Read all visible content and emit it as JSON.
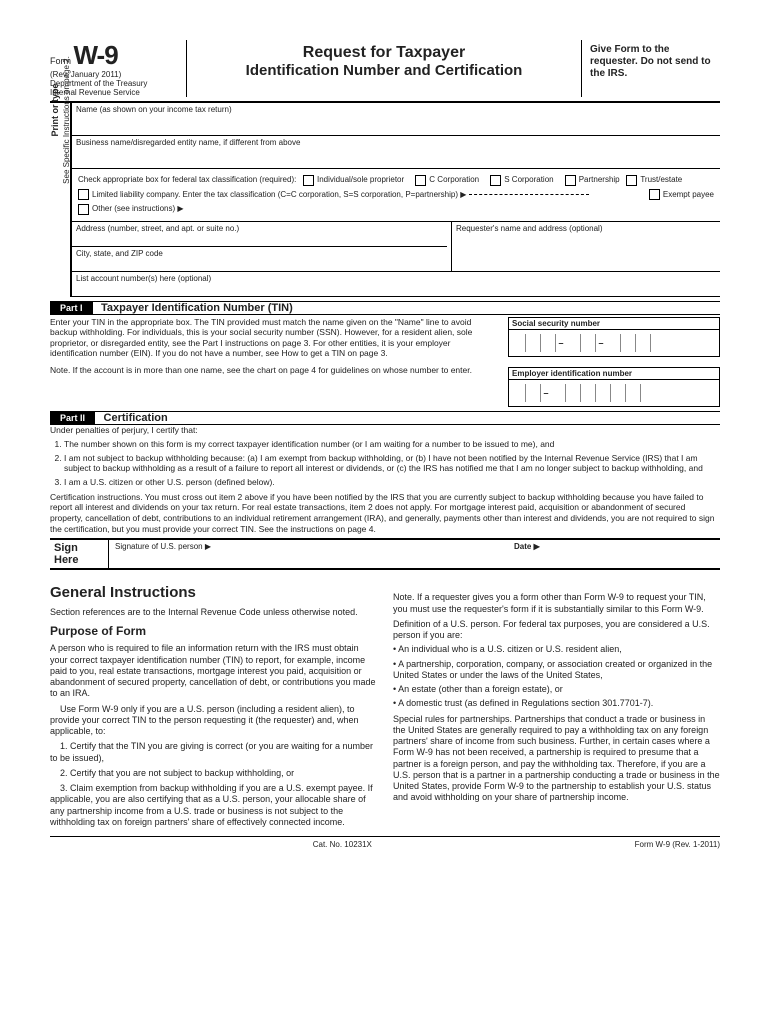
{
  "header": {
    "form_word": "Form",
    "form_number": "W-9",
    "revision": "(Rev. January 2011)",
    "dept": "Department of the Treasury",
    "irs": "Internal Revenue Service",
    "title1": "Request for Taxpayer",
    "title2": "Identification Number and Certification",
    "right": "Give Form to the requester. Do not send to the IRS."
  },
  "side_label_bold": "Print or type",
  "side_label": "See Specific Instructions on page 2.",
  "fields": {
    "name": "Name (as shown on your income tax return)",
    "business": "Business name/disregarded entity name, if different from above",
    "class_intro": "Check appropriate box for federal tax classification (required):",
    "c_individual": "Individual/sole proprietor",
    "c_ccorp": "C Corporation",
    "c_scorp": "S Corporation",
    "c_partnership": "Partnership",
    "c_trust": "Trust/estate",
    "c_exempt": "Exempt payee",
    "c_llc": "Limited liability company. Enter the tax classification (C=C corporation, S=S corporation, P=partnership) ▶",
    "c_other": "Other (see instructions) ▶",
    "address": "Address (number, street, and apt. or suite no.)",
    "requester": "Requester's name and address (optional)",
    "city": "City, state, and ZIP code",
    "accounts": "List account number(s) here (optional)"
  },
  "part1": {
    "label": "Part I",
    "title": "Taxpayer Identification Number (TIN)",
    "p1": "Enter your TIN in the appropriate box. The TIN provided must match the name given on the \"Name\" line to avoid backup withholding. For individuals, this is your social security number (SSN). However, for a resident alien, sole proprietor, or disregarded entity, see the Part I instructions on page 3. For other entities, it is your employer identification number (EIN). If you do not have a number, see How to get a TIN on page 3.",
    "p2": "Note. If the account is in more than one name, see the chart on page 4 for guidelines on whose number to enter.",
    "ssn": "Social security number",
    "ein": "Employer identification number"
  },
  "part2": {
    "label": "Part II",
    "title": "Certification",
    "intro": "Under penalties of perjury, I certify that:",
    "i1": "The number shown on this form is my correct taxpayer identification number (or I am waiting for a number to be issued to me), and",
    "i2": "I am not subject to backup withholding because: (a) I am exempt from backup withholding, or (b) I have not been notified by the Internal Revenue Service (IRS) that I am subject to backup withholding as a result of a failure to report all interest or dividends, or (c) the IRS has notified me that I am no longer subject to backup withholding, and",
    "i3": "I am a U.S. citizen or other U.S. person (defined below).",
    "cert_instr": "Certification instructions. You must cross out item 2 above if you have been notified by the IRS that you are currently subject to backup withholding because you have failed to report all interest and dividends on your tax return. For real estate transactions, item 2 does not apply. For mortgage interest paid, acquisition or abandonment of secured property, cancellation of debt, contributions to an individual retirement arrangement (IRA), and generally, payments other than interest and dividends, you are not required to sign the certification, but you must provide your correct TIN. See the instructions on page 4."
  },
  "sign": {
    "here": "Sign Here",
    "sig": "Signature of U.S. person ▶",
    "date": "Date ▶"
  },
  "instr": {
    "h_general": "General Instructions",
    "p_general": "Section references are to the Internal Revenue Code unless otherwise noted.",
    "h_purpose": "Purpose of Form",
    "p_purpose1": "A person who is required to file an information return with the IRS must obtain your correct taxpayer identification number (TIN) to report, for example, income paid to you, real estate transactions, mortgage interest you paid, acquisition or abandonment of secured property, cancellation of debt, or contributions you made to an IRA.",
    "p_purpose2": "Use Form W-9 only if you are a U.S. person (including a resident alien), to provide your correct TIN to the person requesting it (the requester) and, when applicable, to:",
    "p_li1": "1. Certify that the TIN you are giving is correct (or you are waiting for a number to be issued),",
    "p_li2": "2. Certify that you are not subject to backup withholding, or",
    "p_li3": "3. Claim exemption from backup withholding if you are a U.S. exempt payee. If applicable, you are also certifying that as a U.S. person, your allocable share of any partnership income from a U.S. trade or business is not subject to the withholding tax on foreign partners' share of effectively connected income.",
    "r_note": "Note. If a requester gives you a form other than Form W-9 to request your TIN, you must use the requester's form if it is substantially similar to this Form W-9.",
    "r_def": "Definition of a U.S. person. For federal tax purposes, you are considered a U.S. person if you are:",
    "r_b1": "• An individual who is a U.S. citizen or U.S. resident alien,",
    "r_b2": "• A partnership, corporation, company, or association created or organized in the United States or under the laws of the United States,",
    "r_b3": "• An estate (other than a foreign estate), or",
    "r_b4": "• A domestic trust (as defined in Regulations section 301.7701-7).",
    "r_special": "Special rules for partnerships. Partnerships that conduct a trade or business in the United States are generally required to pay a withholding tax on any foreign partners' share of income from such business. Further, in certain cases where a Form W-9 has not been received, a partnership is required to presume that a partner is a foreign person, and pay the withholding tax. Therefore, if you are a U.S. person that is a partner in a partnership conducting a trade or business in the United States, provide Form W-9 to the partnership to establish your U.S. status and avoid withholding on your share of partnership income."
  },
  "footer": {
    "cat": "Cat. No. 10231X",
    "form": "Form W-9 (Rev. 1-2011)"
  }
}
